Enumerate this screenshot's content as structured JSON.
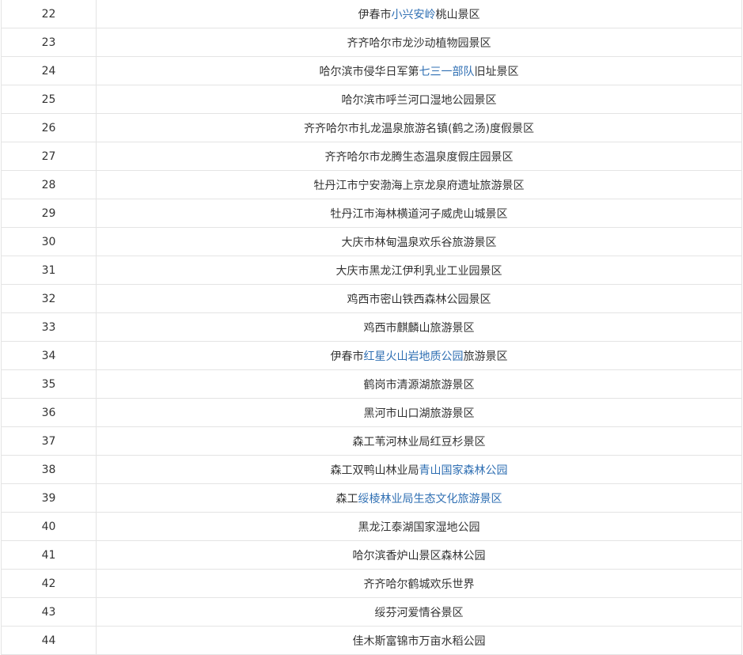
{
  "rows": [
    {
      "num": "22",
      "name": [
        {
          "t": "伊春市"
        },
        {
          "t": "小兴安岭",
          "link": true
        },
        {
          "t": "桃山景区"
        }
      ]
    },
    {
      "num": "23",
      "name": [
        {
          "t": "齐齐哈尔市龙沙动植物园景区"
        }
      ]
    },
    {
      "num": "24",
      "name": [
        {
          "t": "哈尔滨市侵华日军第"
        },
        {
          "t": "七三一部队",
          "link": true
        },
        {
          "t": "旧址景区"
        }
      ]
    },
    {
      "num": "25",
      "name": [
        {
          "t": "哈尔滨市呼兰河口湿地公园景区"
        }
      ]
    },
    {
      "num": "26",
      "name": [
        {
          "t": "齐齐哈尔市扎龙温泉旅游名镇(鹤之汤)度假景区"
        }
      ]
    },
    {
      "num": "27",
      "name": [
        {
          "t": "齐齐哈尔市龙腾生态温泉度假庄园景区"
        }
      ]
    },
    {
      "num": "28",
      "name": [
        {
          "t": "牡丹江市宁安渤海上京龙泉府遗址旅游景区"
        }
      ]
    },
    {
      "num": "29",
      "name": [
        {
          "t": "牡丹江市海林横道河子威虎山城景区"
        }
      ]
    },
    {
      "num": "30",
      "name": [
        {
          "t": "大庆市林甸温泉欢乐谷旅游景区"
        }
      ]
    },
    {
      "num": "31",
      "name": [
        {
          "t": "大庆市黑龙江伊利乳业工业园景区"
        }
      ]
    },
    {
      "num": "32",
      "name": [
        {
          "t": "鸡西市密山铁西森林公园景区"
        }
      ]
    },
    {
      "num": "33",
      "name": [
        {
          "t": "鸡西市麒麟山旅游景区"
        }
      ]
    },
    {
      "num": "34",
      "name": [
        {
          "t": "伊春市"
        },
        {
          "t": "红星火山岩地质公园",
          "link": true
        },
        {
          "t": "旅游景区"
        }
      ]
    },
    {
      "num": "35",
      "name": [
        {
          "t": "鹤岗市清源湖旅游景区"
        }
      ]
    },
    {
      "num": "36",
      "name": [
        {
          "t": "黑河市山口湖旅游景区"
        }
      ]
    },
    {
      "num": "37",
      "name": [
        {
          "t": "森工苇河林业局红豆杉景区"
        }
      ]
    },
    {
      "num": "38",
      "name": [
        {
          "t": "森工双鸭山林业局"
        },
        {
          "t": "青山国家森林公园",
          "link": true
        }
      ]
    },
    {
      "num": "39",
      "name": [
        {
          "t": "森工"
        },
        {
          "t": "绥棱林业局生态文化旅游景区",
          "link": true
        }
      ]
    },
    {
      "num": "40",
      "name": [
        {
          "t": "黑龙江泰湖国家湿地公园"
        }
      ]
    },
    {
      "num": "41",
      "name": [
        {
          "t": "哈尔滨香炉山景区森林公园"
        }
      ]
    },
    {
      "num": "42",
      "name": [
        {
          "t": "齐齐哈尔鹤城欢乐世界"
        }
      ]
    },
    {
      "num": "43",
      "name": [
        {
          "t": "绥芬河爱情谷景区"
        }
      ]
    },
    {
      "num": "44",
      "name": [
        {
          "t": "佳木斯富锦市万亩水稻公园"
        }
      ]
    }
  ],
  "colors": {
    "link": "#2f6fb3",
    "text": "#333333",
    "border": "#e4e4e4"
  }
}
